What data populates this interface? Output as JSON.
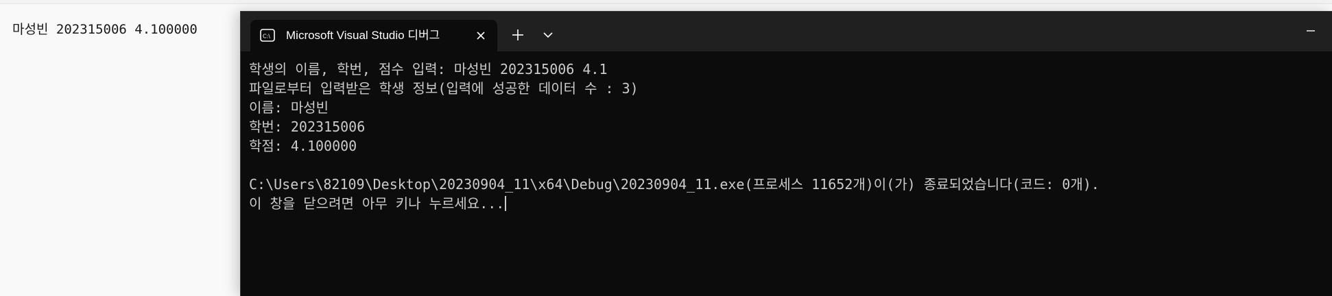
{
  "background_window": {
    "text": "마성빈 202315006 4.100000"
  },
  "terminal": {
    "tab_title": "Microsoft Visual Studio 디버그",
    "icons": {
      "tab": "console-icon",
      "close": "close-icon",
      "new_tab": "plus-icon",
      "dropdown": "chevron-down-icon",
      "minimize": "minimize-icon"
    },
    "lines": [
      "학생의 이름, 학번, 점수 입력: 마성빈 202315006 4.1",
      "파일로부터 입력받은 학생 정보(입력에 성공한 데이터 수 : 3)",
      "이름: 마성빈",
      "학번: 202315006",
      "학점: 4.100000",
      "",
      "C:\\Users\\82109\\Desktop\\20230904_11\\x64\\Debug\\20230904_11.exe(프로세스 11652개)이(가) 종료되었습니다(코드: 0개).",
      "이 창을 닫으려면 아무 키나 누르세요..."
    ]
  },
  "colors": {
    "terminal_bg": "#0c0c0c",
    "titlebar_bg": "#202020",
    "text": "#cccccc"
  }
}
